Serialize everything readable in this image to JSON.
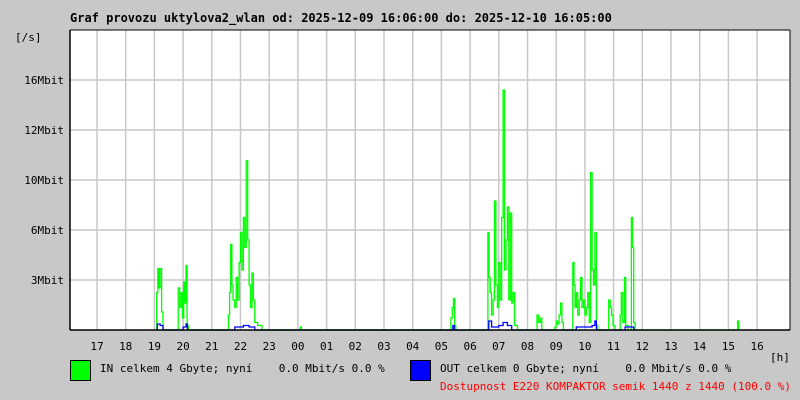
{
  "chart_data": {
    "type": "line",
    "title": "Graf provozu uktylova2_wlan od: 2025-12-09 16:06:00 do: 2025-12-10 16:05:00",
    "ylabel": "[/s]",
    "xlabel": "[h]",
    "ylim": [
      0,
      20
    ],
    "xlim": [
      16.06,
      40.1
    ],
    "y_ticks": [
      {
        "value": 3.33,
        "label": "3Mbit"
      },
      {
        "value": 6.67,
        "label": "6Mbit"
      },
      {
        "value": 10,
        "label": "10Mbit"
      },
      {
        "value": 13.33,
        "label": "12Mbit"
      },
      {
        "value": 16.67,
        "label": "16Mbit"
      }
    ],
    "x_ticks": [
      "17",
      "18",
      "19",
      "20",
      "21",
      "22",
      "23",
      "00",
      "01",
      "02",
      "03",
      "04",
      "05",
      "06",
      "07",
      "08",
      "09",
      "10",
      "11",
      "12",
      "13",
      "14",
      "15",
      "16"
    ],
    "x_tick_start_hour": 17,
    "grid": true,
    "series": [
      {
        "name": "IN",
        "color": "#00ff00",
        "points": [
          [
            19.05,
            0
          ],
          [
            19.08,
            2.5
          ],
          [
            19.12,
            4.1
          ],
          [
            19.16,
            2.8
          ],
          [
            19.2,
            4.1
          ],
          [
            19.25,
            1.2
          ],
          [
            19.3,
            0
          ],
          [
            19.8,
            0
          ],
          [
            19.83,
            2.8
          ],
          [
            19.88,
            1.5
          ],
          [
            19.93,
            2.5
          ],
          [
            19.98,
            0.8
          ],
          [
            20.02,
            3.2
          ],
          [
            20.06,
            1.8
          ],
          [
            20.1,
            4.3
          ],
          [
            20.14,
            0.3
          ],
          [
            20.18,
            0
          ],
          [
            21.55,
            0
          ],
          [
            21.58,
            1
          ],
          [
            21.62,
            2.5
          ],
          [
            21.66,
            5.7
          ],
          [
            21.7,
            3
          ],
          [
            21.74,
            2
          ],
          [
            21.8,
            1.5
          ],
          [
            21.85,
            3.5
          ],
          [
            21.9,
            2
          ],
          [
            21.95,
            4.5
          ],
          [
            22.0,
            6.5
          ],
          [
            22.05,
            4
          ],
          [
            22.1,
            7.5
          ],
          [
            22.15,
            5.5
          ],
          [
            22.2,
            11.3
          ],
          [
            22.25,
            6
          ],
          [
            22.3,
            3
          ],
          [
            22.35,
            1.5
          ],
          [
            22.4,
            3.8
          ],
          [
            22.45,
            2
          ],
          [
            22.5,
            0.5
          ],
          [
            22.6,
            0.3
          ],
          [
            22.75,
            0
          ],
          [
            24.05,
            0
          ],
          [
            24.08,
            0.2
          ],
          [
            24.12,
            0
          ],
          [
            29.3,
            0
          ],
          [
            29.33,
            0.8
          ],
          [
            29.38,
            1.5
          ],
          [
            29.42,
            2.1
          ],
          [
            29.46,
            0.3
          ],
          [
            29.5,
            0
          ],
          [
            30.6,
            0
          ],
          [
            30.62,
            6.5
          ],
          [
            30.66,
            3.5
          ],
          [
            30.7,
            2.5
          ],
          [
            30.75,
            1
          ],
          [
            30.8,
            2
          ],
          [
            30.85,
            8.6
          ],
          [
            30.9,
            3
          ],
          [
            30.95,
            1.5
          ],
          [
            31.0,
            4.5
          ],
          [
            31.05,
            2
          ],
          [
            31.1,
            7.5
          ],
          [
            31.15,
            16
          ],
          [
            31.2,
            4
          ],
          [
            31.25,
            6
          ],
          [
            31.3,
            8.2
          ],
          [
            31.35,
            2
          ],
          [
            31.4,
            7.8
          ],
          [
            31.45,
            1.8
          ],
          [
            31.5,
            2.5
          ],
          [
            31.55,
            0.3
          ],
          [
            31.65,
            0
          ],
          [
            32.3,
            0
          ],
          [
            32.33,
            1
          ],
          [
            32.38,
            0.5
          ],
          [
            32.45,
            0.8
          ],
          [
            32.5,
            0
          ],
          [
            32.9,
            0
          ],
          [
            32.95,
            0.2
          ],
          [
            33.0,
            0.6
          ],
          [
            33.05,
            0.4
          ],
          [
            33.1,
            1
          ],
          [
            33.15,
            1.8
          ],
          [
            33.2,
            0.5
          ],
          [
            33.25,
            0
          ],
          [
            33.55,
            0
          ],
          [
            33.58,
            4.5
          ],
          [
            33.62,
            3
          ],
          [
            33.66,
            1.5
          ],
          [
            33.7,
            2.5
          ],
          [
            33.75,
            1
          ],
          [
            33.8,
            2
          ],
          [
            33.85,
            3.5
          ],
          [
            33.9,
            1.5
          ],
          [
            33.95,
            2
          ],
          [
            34.0,
            1
          ],
          [
            34.05,
            1.5
          ],
          [
            34.1,
            2.5
          ],
          [
            34.15,
            0.5
          ],
          [
            34.2,
            10.5
          ],
          [
            34.25,
            4
          ],
          [
            34.3,
            3
          ],
          [
            34.35,
            6.5
          ],
          [
            34.4,
            0.3
          ],
          [
            34.45,
            0
          ],
          [
            34.8,
            0
          ],
          [
            34.83,
            2
          ],
          [
            34.88,
            1.5
          ],
          [
            34.93,
            1
          ],
          [
            34.98,
            0.3
          ],
          [
            35.05,
            0
          ],
          [
            35.2,
            0
          ],
          [
            35.23,
            1
          ],
          [
            35.27,
            2.5
          ],
          [
            35.32,
            0.5
          ],
          [
            35.38,
            3.5
          ],
          [
            35.42,
            0.3
          ],
          [
            35.5,
            0
          ],
          [
            35.6,
            0
          ],
          [
            35.62,
            7.5
          ],
          [
            35.66,
            5.5
          ],
          [
            35.7,
            0.5
          ],
          [
            35.75,
            0
          ],
          [
            39.3,
            0
          ],
          [
            39.32,
            0.6
          ],
          [
            39.36,
            0
          ]
        ]
      },
      {
        "name": "OUT",
        "color": "#0000ff",
        "points": [
          [
            19.05,
            0
          ],
          [
            19.1,
            0.4
          ],
          [
            19.2,
            0.3
          ],
          [
            19.3,
            0
          ],
          [
            19.85,
            0
          ],
          [
            20.0,
            0.2
          ],
          [
            20.1,
            0.4
          ],
          [
            20.15,
            0
          ],
          [
            21.65,
            0
          ],
          [
            21.8,
            0.2
          ],
          [
            22.1,
            0.3
          ],
          [
            22.3,
            0.2
          ],
          [
            22.5,
            0
          ],
          [
            29.35,
            0
          ],
          [
            29.4,
            0.3
          ],
          [
            29.45,
            0
          ],
          [
            30.6,
            0
          ],
          [
            30.65,
            0.6
          ],
          [
            30.75,
            0.2
          ],
          [
            31.0,
            0.3
          ],
          [
            31.15,
            0.5
          ],
          [
            31.3,
            0.3
          ],
          [
            31.45,
            0
          ],
          [
            33.6,
            0
          ],
          [
            33.7,
            0.2
          ],
          [
            34.25,
            0.3
          ],
          [
            34.35,
            0.6
          ],
          [
            34.4,
            0
          ],
          [
            35.3,
            0
          ],
          [
            35.4,
            0.2
          ],
          [
            35.6,
            0.2
          ],
          [
            35.7,
            0
          ]
        ]
      }
    ]
  },
  "legend": {
    "in_text": "IN celkem 4 Gbyte; nyní    0.0 Mbit/s 0.0 %",
    "out_text": "OUT celkem 0 Gbyte; nyní    0.0 Mbit/s 0.0 %",
    "availability": "Dostupnost E220 KOMPAKTOR semik 1440 z 1440 (100.0 %)"
  }
}
